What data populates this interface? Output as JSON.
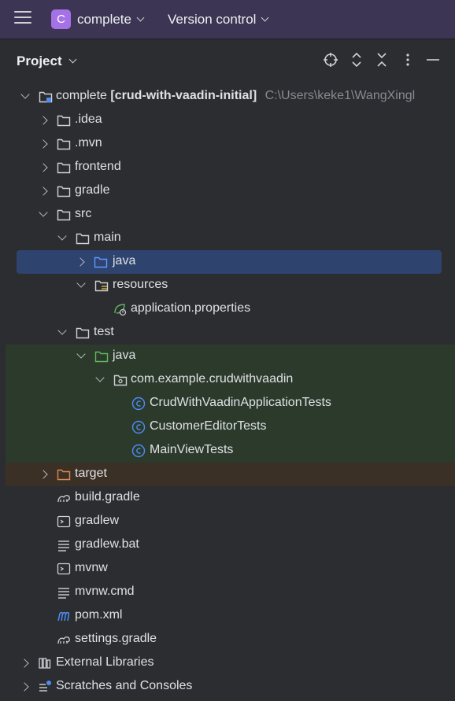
{
  "topbar": {
    "project_letter": "C",
    "project_name": "complete",
    "version_control": "Version control"
  },
  "panel": {
    "title": "Project"
  },
  "tree": {
    "root": {
      "name": "complete",
      "module": "[crud-with-vaadin-initial]",
      "path": "C:\\Users\\keke1\\WangXingl"
    },
    "idea": ".idea",
    "mvn": ".mvn",
    "frontend": "frontend",
    "gradle": "gradle",
    "src": "src",
    "main": "main",
    "main_java": "java",
    "resources": "resources",
    "app_props": "application.properties",
    "test": "test",
    "test_java": "java",
    "package": "com.example.crudwithvaadin",
    "test1": "CrudWithVaadinApplicationTests",
    "test2": "CustomerEditorTests",
    "test3": "MainViewTests",
    "target": "target",
    "build_gradle": "build.gradle",
    "gradlew": "gradlew",
    "gradlew_bat": "gradlew.bat",
    "mvnw": "mvnw",
    "mvnw_cmd": "mvnw.cmd",
    "pom": "pom.xml",
    "settings_gradle": "settings.gradle",
    "ext_libs": "External Libraries",
    "scratches": "Scratches and Consoles"
  },
  "colors": {
    "topbar": "#3c3553",
    "panel": "#2b2d30",
    "selection": "#2e436e",
    "test_sources": "#2c3a2c",
    "excluded": "#3b3026",
    "class_icon": "#4c8df6",
    "accent": "#a571e6"
  }
}
